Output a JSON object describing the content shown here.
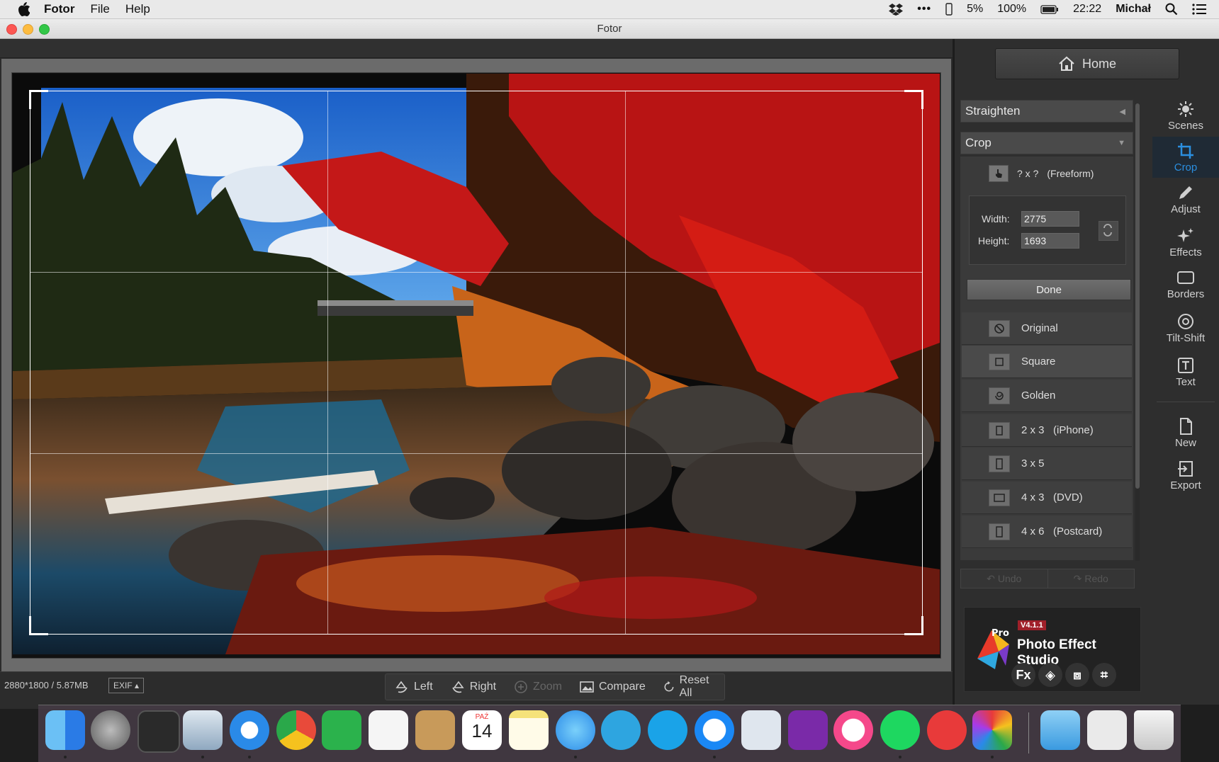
{
  "menubar": {
    "app": "Fotor",
    "items": [
      "File",
      "Help"
    ],
    "battery": "5%",
    "zoom": "100%",
    "time": "22:22",
    "user": "Michał"
  },
  "window": {
    "title": "Fotor"
  },
  "status": {
    "info": "2880*1800 / 5.87MB",
    "exif": "EXIF ▴"
  },
  "toolbar": {
    "left": "Left",
    "right": "Right",
    "zoom": "Zoom",
    "compare": "Compare",
    "reset": "Reset All"
  },
  "panel": {
    "home": "Home",
    "straighten": "Straighten",
    "crop": "Crop",
    "freeform_label": "? x ?",
    "freeform_name": "(Freeform)",
    "width_label": "Width:",
    "width_value": "2775",
    "height_label": "Height:",
    "height_value": "1693",
    "done": "Done",
    "ratios": [
      {
        "label": "Original",
        "selected": false
      },
      {
        "label": "Square",
        "selected": true
      },
      {
        "label": "Golden",
        "selected": false
      },
      {
        "label": "2 x 3   (iPhone)",
        "selected": false
      },
      {
        "label": "3 x 5",
        "selected": false
      },
      {
        "label": "4 x 3   (DVD)",
        "selected": false
      },
      {
        "label": "4 x 6   (Postcard)",
        "selected": false
      }
    ],
    "undo": "Undo",
    "redo": "Redo"
  },
  "promo": {
    "version": "V4.1.1",
    "title": "Photo Effect Studio",
    "fx": "Fx"
  },
  "tools": [
    {
      "name": "Scenes",
      "icon": "sun-icon",
      "active": false
    },
    {
      "name": "Crop",
      "icon": "crop-icon",
      "active": true
    },
    {
      "name": "Adjust",
      "icon": "pencil-icon",
      "active": false
    },
    {
      "name": "Effects",
      "icon": "sparkle-icon",
      "active": false
    },
    {
      "name": "Borders",
      "icon": "border-icon",
      "active": false
    },
    {
      "name": "Tilt-Shift",
      "icon": "target-icon",
      "active": false
    },
    {
      "name": "Text",
      "icon": "text-icon",
      "active": false
    },
    {
      "name": "New",
      "icon": "new-file-icon",
      "active": false
    },
    {
      "name": "Export",
      "icon": "export-icon",
      "active": false
    }
  ],
  "dock": {
    "calendar_month": "PAŹ",
    "calendar_day": "14"
  },
  "colors": {
    "accent": "#2b8fe0",
    "panel": "#2e2e2e",
    "canvas": "#6b6b6b"
  }
}
